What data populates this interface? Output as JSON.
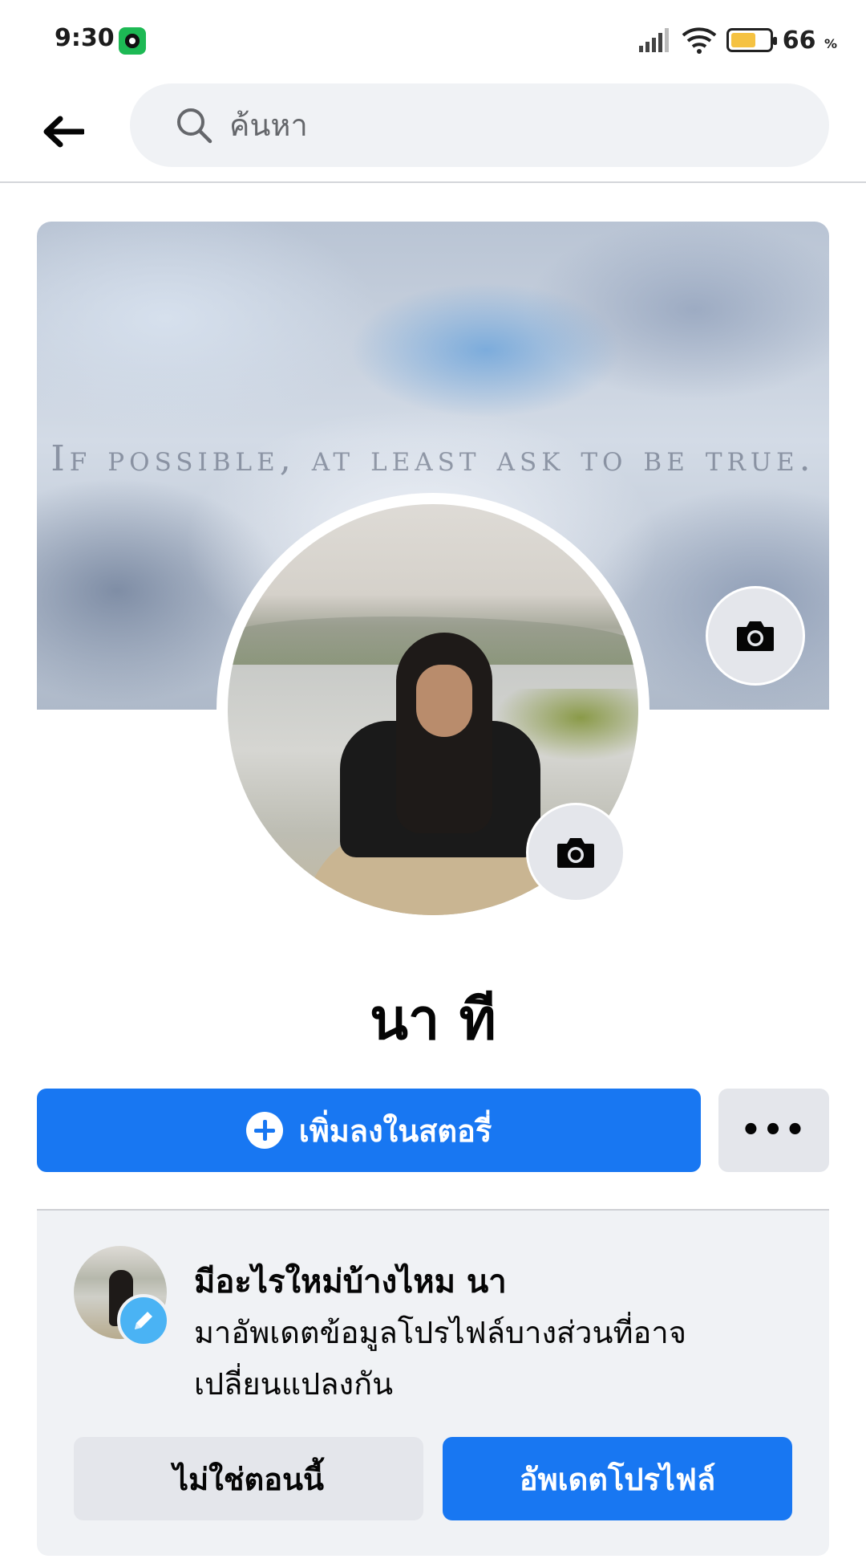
{
  "status_bar": {
    "time": "9:30",
    "app_icon": "music-app-icon",
    "signal_icon": "signal-bars-icon",
    "wifi_icon": "wifi-icon",
    "battery_level": 0.66,
    "battery_percent": "66",
    "battery_unit": "%",
    "battery_color": "#f5c242"
  },
  "header": {
    "back_icon": "arrow-left-icon",
    "search_icon": "search-icon",
    "search_placeholder": "ค้นหา",
    "search_value": ""
  },
  "cover": {
    "quote": "If possible, at least ask to be true.",
    "camera_icon": "camera-icon"
  },
  "profile": {
    "name": "นา ที",
    "avatar_camera_icon": "camera-icon"
  },
  "actions": {
    "add_story_label": "เพิ่มลงในสตอรี่",
    "add_story_icon": "plus-circle-icon",
    "more_label": "•••"
  },
  "update_card": {
    "title": "มีอะไรใหม่บ้างไหม นา",
    "description": "มาอัพเดตข้อมูลโปรไฟล์บางส่วนที่อาจเปลี่ยนแปลงกัน",
    "edit_icon": "pencil-icon",
    "not_now_label": "ไม่ใช่ตอนนี้",
    "update_label": "อัพเดตโปรไฟล์"
  },
  "colors": {
    "accent": "#1877f2",
    "secondary_button": "#e4e6eb",
    "card_background": "#f0f2f5"
  }
}
